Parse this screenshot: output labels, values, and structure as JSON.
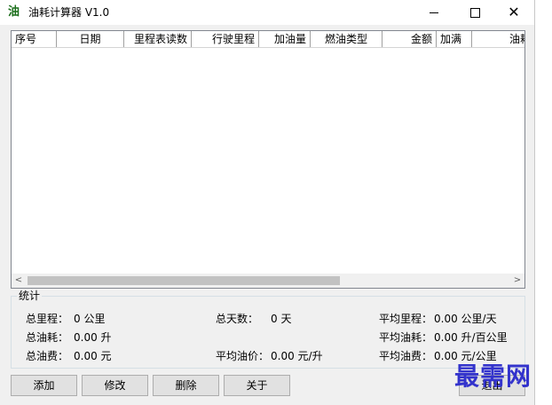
{
  "window": {
    "title": "油耗计算器 V1.0",
    "icon_glyph": "油",
    "close_glyph": "✕"
  },
  "table": {
    "columns": [
      "序号",
      "日期",
      "里程表读数",
      "行驶里程",
      "加油量",
      "燃油类型",
      "金额",
      "加满",
      "油耗"
    ],
    "rows": []
  },
  "scrollbar": {
    "left_arrow": "<",
    "right_arrow": ">"
  },
  "stats": {
    "legend": "统计",
    "total_mileage_label": "总里程：",
    "total_mileage_value": "0 公里",
    "total_days_label": "总天数：",
    "total_days_value": "0 天",
    "avg_mileage_label": "平均里程：",
    "avg_mileage_value": "0.00 公里/天",
    "total_fuel_label": "总油耗：",
    "total_fuel_value": "0.00 升",
    "avg_fuel_label": "平均油耗：",
    "avg_fuel_value": "0.00 升/百公里",
    "total_cost_label": "总油费：",
    "total_cost_value": "0.00 元",
    "avg_price_label": "平均油价：",
    "avg_price_value": "0.00 元/升",
    "avg_cost_label": "平均油费：",
    "avg_cost_value": "0.00 元/公里"
  },
  "buttons": {
    "add": "添加",
    "edit": "修改",
    "delete": "删除",
    "about": "关于",
    "exit": "退出"
  },
  "watermark": "最需网",
  "colors": {
    "app_icon": "#1a6e1a",
    "watermark": "#3333cc"
  }
}
